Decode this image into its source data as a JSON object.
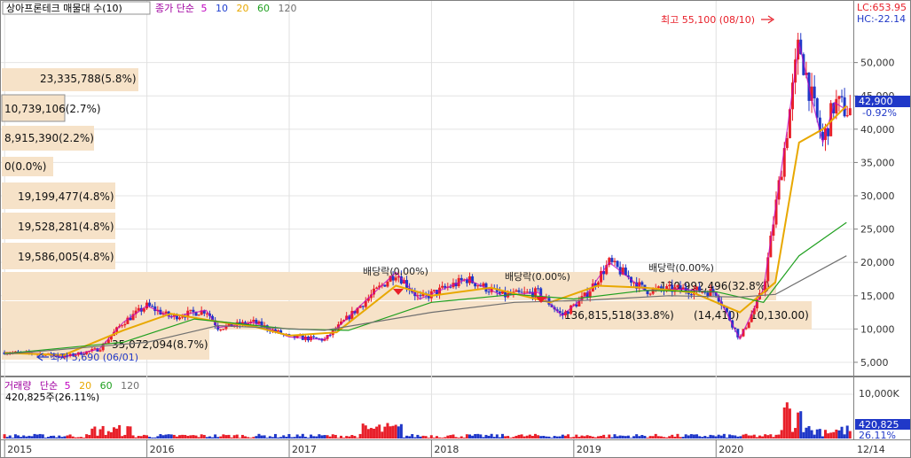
{
  "header": {
    "title": "상아프론테크 매물대 수(10)",
    "ma_prefix": "종가 단순",
    "ma_periods": [
      "5",
      "10",
      "20",
      "60",
      "120"
    ]
  },
  "lc_label": "LC:653.95",
  "hc_label": "HC:-22.14",
  "max_label": "최고 55,100 (08/10)",
  "min_label": "최저 5,690 (06/01)",
  "dividend_labels": [
    "배당락(0.00%)",
    "배당락(0.00%)",
    "배당락(0.00%)"
  ],
  "current_price": "42,900",
  "current_change": "-0.92%",
  "volume_header": {
    "title": "거래량",
    "ma_prefix": "단순",
    "ma_periods": [
      "5",
      "20",
      "60",
      "120"
    ],
    "current": "420,825주(26.11%)"
  },
  "volume_axis": [
    "10,000K"
  ],
  "volume_current": "420,825",
  "volume_current_pct": "26.11%",
  "price_axis": [
    "50,000",
    "45,000",
    "40,000",
    "35,000",
    "30,000",
    "25,000",
    "20,000",
    "15,000",
    "10,000",
    "5,000"
  ],
  "x_axis": [
    "2015",
    "2016",
    "2017",
    "2018",
    "2019",
    "2020",
    "12/14"
  ],
  "volume_profile": [
    {
      "label": "23,335,788(5.8%)",
      "zone": [
        45000,
        50000
      ]
    },
    {
      "label": "10,739,106(2.7%)",
      "zone": [
        40000,
        45000
      ]
    },
    {
      "label": "8,915,390(2.2%)",
      "zone": [
        35000,
        40000
      ]
    },
    {
      "label": "0(0.0%)",
      "zone": [
        30000,
        35000
      ]
    },
    {
      "label": "19,199,477(4.8%)",
      "zone": [
        25000,
        30000
      ]
    },
    {
      "label": "19,528,281(4.8%)",
      "zone": [
        20000,
        25000
      ]
    },
    {
      "label": "19,586,005(4.8%)",
      "zone": [
        15000,
        20000
      ]
    },
    {
      "label": "130,992,496(32.8%)",
      "zone": [
        10000,
        15000
      ]
    },
    {
      "label": "136,815,518(33.8%)",
      "zone": [
        10000,
        15000
      ]
    },
    {
      "label": "(14,410)",
      "zone": [
        10000,
        15000
      ]
    },
    {
      "label": "10,130.00)",
      "zone": [
        10000,
        15000
      ]
    },
    {
      "label": "35,072,094(8.7%)",
      "zone": [
        5000,
        10000
      ]
    }
  ],
  "colors": {
    "up": "#e8202a",
    "down": "#2038c8",
    "ma5": "#c000c0",
    "ma10": "#2040d0",
    "ma20": "#e8a800",
    "ma60": "#20a020",
    "ma120": "#707070",
    "profile": "#f6e2c8"
  },
  "chart_data": {
    "type": "line",
    "title": "상아프론테크 매물대 수(10)",
    "ylim": [
      3000,
      57000
    ],
    "xlim": [
      "2015-01",
      "2020-12-14"
    ],
    "series": [
      {
        "name": "종가",
        "points": [
          [
            "2015-01",
            6500
          ],
          [
            "2015-04",
            6300
          ],
          [
            "2015-06",
            5800
          ],
          [
            "2015-09",
            7000
          ],
          [
            "2015-11",
            11000
          ],
          [
            "2016-01",
            13500
          ],
          [
            "2016-03",
            11800
          ],
          [
            "2016-06",
            12800
          ],
          [
            "2016-07",
            10200
          ],
          [
            "2016-10",
            11000
          ],
          [
            "2017-01",
            8800
          ],
          [
            "2017-04",
            8400
          ],
          [
            "2017-07",
            13500
          ],
          [
            "2017-10",
            18500
          ],
          [
            "2017-12",
            14500
          ],
          [
            "2018-04",
            17500
          ],
          [
            "2018-07",
            15000
          ],
          [
            "2018-10",
            15500
          ],
          [
            "2018-12",
            12000
          ],
          [
            "2019-02",
            15000
          ],
          [
            "2019-04",
            20000
          ],
          [
            "2019-07",
            15800
          ],
          [
            "2019-10",
            16000
          ],
          [
            "2020-01",
            15500
          ],
          [
            "2020-03",
            8500
          ],
          [
            "2020-05",
            16000
          ],
          [
            "2020-07",
            40000
          ],
          [
            "2020-08",
            53000
          ],
          [
            "2020-09",
            45000
          ],
          [
            "2020-10",
            38000
          ],
          [
            "2020-11",
            44000
          ],
          [
            "2020-12",
            42900
          ]
        ]
      },
      {
        "name": "20",
        "points": [
          [
            "2015-01",
            6400
          ],
          [
            "2015-06",
            6100
          ],
          [
            "2015-11",
            9800
          ],
          [
            "2016-03",
            12300
          ],
          [
            "2016-07",
            11100
          ],
          [
            "2016-10",
            10400
          ],
          [
            "2017-01",
            9000
          ],
          [
            "2017-05",
            9500
          ],
          [
            "2017-10",
            16500
          ],
          [
            "2018-01",
            15000
          ],
          [
            "2018-06",
            16200
          ],
          [
            "2018-11",
            14000
          ],
          [
            "2019-03",
            16500
          ],
          [
            "2019-07",
            16200
          ],
          [
            "2019-11",
            15500
          ],
          [
            "2020-03",
            12500
          ],
          [
            "2020-06",
            17000
          ],
          [
            "2020-08",
            38000
          ],
          [
            "2020-10",
            40000
          ],
          [
            "2020-12",
            43500
          ]
        ]
      },
      {
        "name": "60",
        "points": [
          [
            "2015-01",
            6300
          ],
          [
            "2015-11",
            8000
          ],
          [
            "2016-05",
            11500
          ],
          [
            "2017-01",
            10000
          ],
          [
            "2017-06",
            9800
          ],
          [
            "2018-01",
            14000
          ],
          [
            "2018-08",
            15200
          ],
          [
            "2019-01",
            14500
          ],
          [
            "2019-07",
            15800
          ],
          [
            "2020-01",
            15600
          ],
          [
            "2020-05",
            14000
          ],
          [
            "2020-08",
            21000
          ],
          [
            "2020-12",
            26000
          ]
        ]
      },
      {
        "name": "120",
        "points": [
          [
            "2015-01",
            6200
          ],
          [
            "2016-01",
            8000
          ],
          [
            "2016-07",
            10500
          ],
          [
            "2017-04",
            9800
          ],
          [
            "2018-01",
            12500
          ],
          [
            "2018-08",
            14000
          ],
          [
            "2019-02",
            14300
          ],
          [
            "2019-09",
            15000
          ],
          [
            "2020-03",
            14800
          ],
          [
            "2020-06",
            15200
          ],
          [
            "2020-12",
            21000
          ]
        ]
      }
    ],
    "volume": {
      "type": "bar",
      "ylim": [
        0,
        12000000
      ],
      "ticks": [
        10000000
      ]
    }
  }
}
